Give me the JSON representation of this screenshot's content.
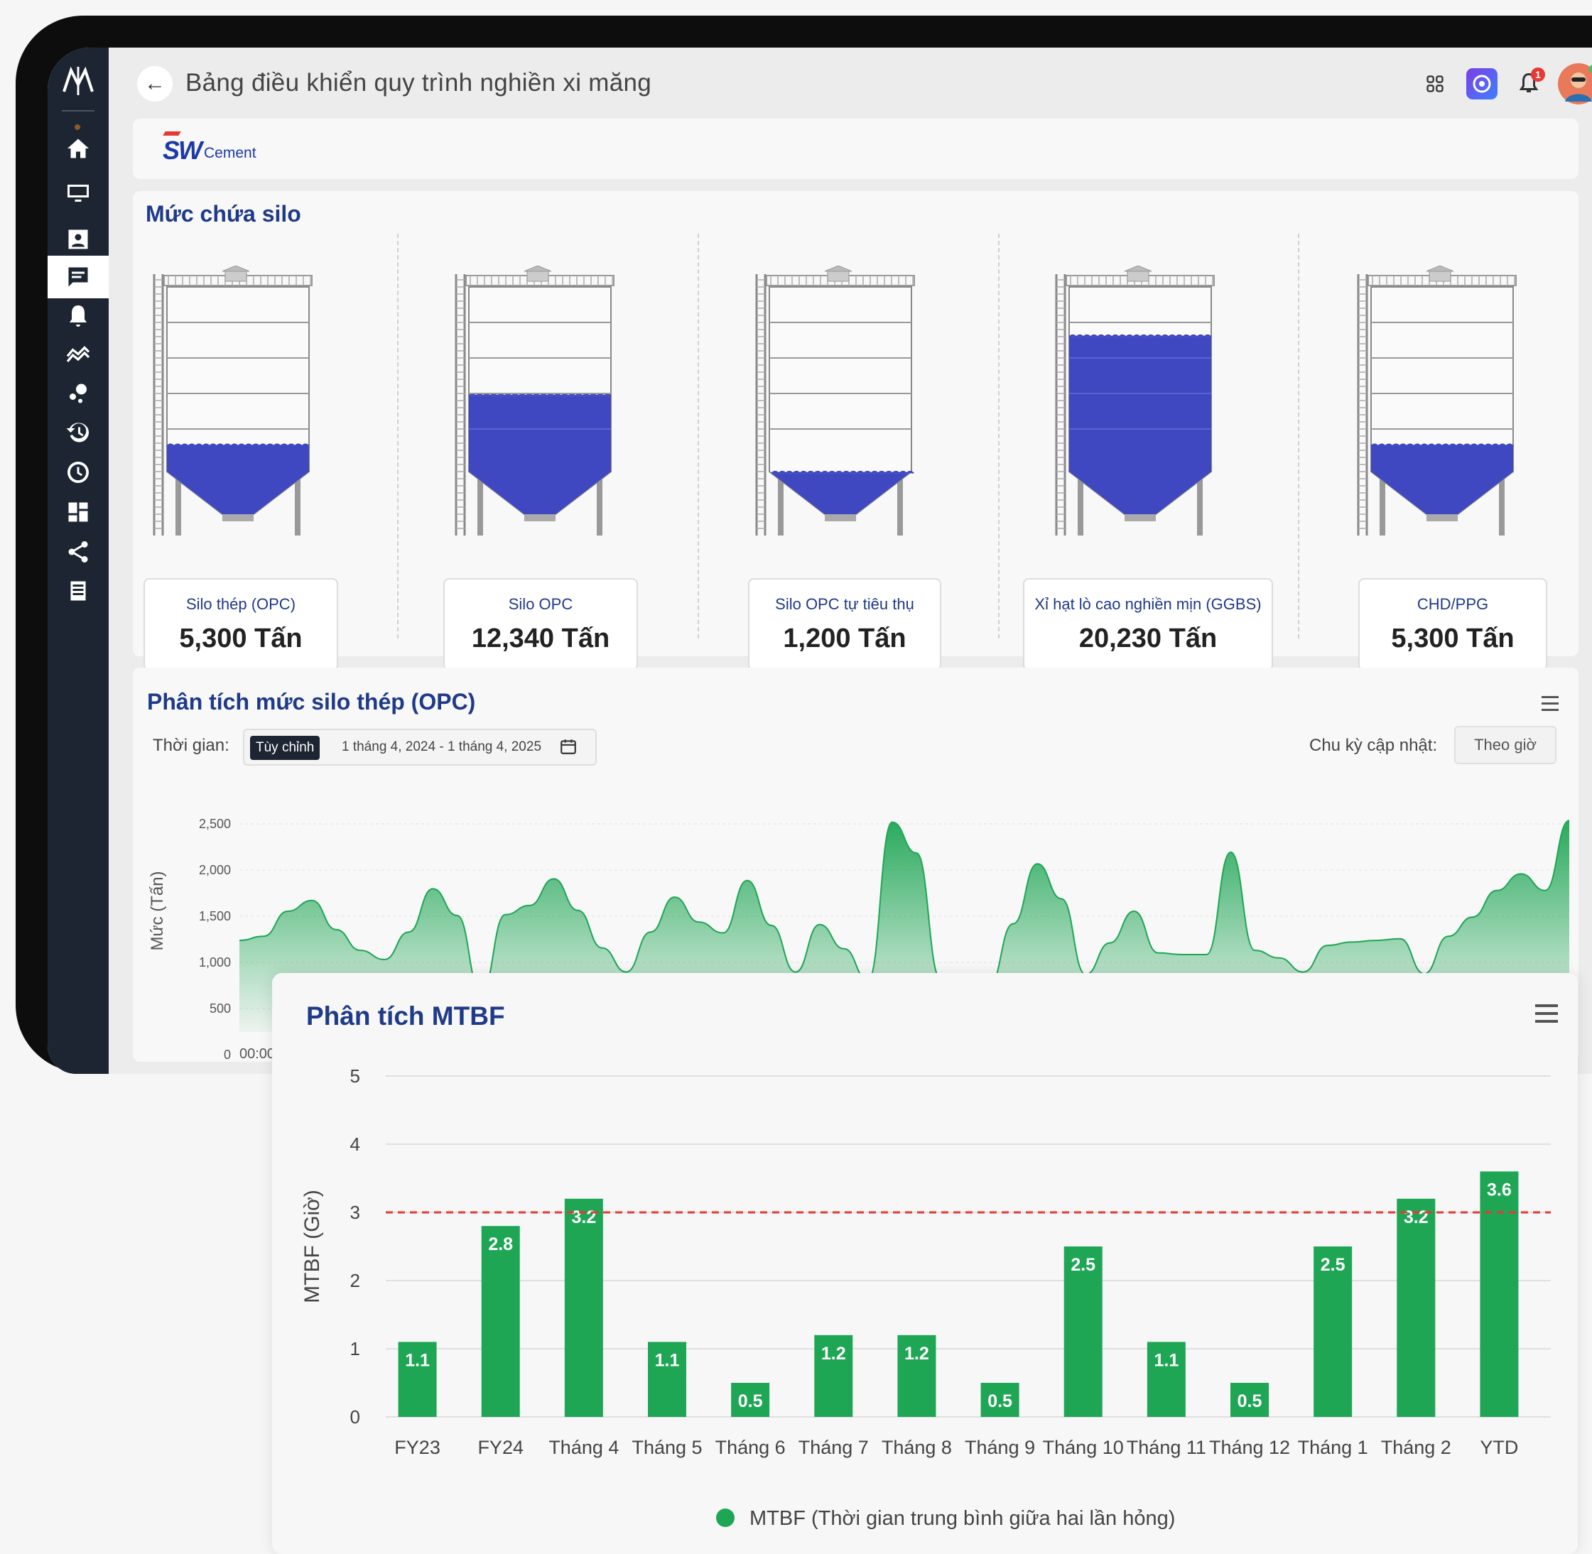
{
  "header": {
    "title": "Bảng điều khiển quy trình nghiền xi măng",
    "back_icon": "←",
    "notification_badge": "1"
  },
  "brand": {
    "sw": "SW",
    "cement": "Cement"
  },
  "silo_section": {
    "title": "Mức chứa silo",
    "fill_color": "#3f48c0",
    "silos": [
      {
        "name": "Silo thép (OPC)",
        "value": "5,300 Tấn",
        "fill_level": 0.3
      },
      {
        "name": "Silo OPC",
        "value": "12,340 Tấn",
        "fill_level": 0.52
      },
      {
        "name": "Silo OPC tự tiêu thụ",
        "value": "1,200 Tấn",
        "fill_level": 0.18
      },
      {
        "name": "Xỉ hạt lò cao nghiền mịn (GGBS)",
        "value": "20,230 Tấn",
        "fill_level": 0.78
      },
      {
        "name": "CHD/PPG",
        "value": "5,300 Tấn",
        "fill_level": 0.3
      }
    ]
  },
  "level_chart": {
    "title": "Phân tích mức silo thép (OPC)",
    "time_label": "Thời gian:",
    "custom_chip": "Tùy chỉnh",
    "date_range": "1 tháng 4, 2024 - 1 tháng 4, 2025",
    "cycle_label": "Chu kỳ cập nhật:",
    "cycle_value": "Theo giờ",
    "ylabel": "Mức (Tấn)",
    "y_ticks": [
      "0",
      "500",
      "1,000",
      "1,500",
      "2,000",
      "2,500"
    ],
    "x_first_tick": "00:00",
    "color": "#1fa655"
  },
  "chart_data": [
    {
      "type": "area",
      "title": "Phân tích mức silo thép (OPC)",
      "ylabel": "Mức (Tấn)",
      "ylim": [
        0,
        2500
      ],
      "x": [
        "00:00"
      ],
      "series": [
        {
          "values": [
            1100,
            1150,
            1450,
            1580,
            1230,
            980,
            870,
            1200,
            1720,
            1400,
            470,
            1410,
            1520,
            1840,
            1460,
            1010,
            720,
            1200,
            1620,
            1320,
            1190,
            1820,
            1280,
            720,
            1290,
            1000,
            620,
            2520,
            2150,
            640,
            420,
            550,
            1300,
            2020,
            1600,
            690,
            1070,
            1450,
            950,
            930,
            930,
            2160,
            980,
            890,
            720,
            1040,
            1080,
            1100,
            1120,
            700,
            1150,
            1380,
            1700,
            1900,
            1700,
            2540
          ]
        }
      ]
    },
    {
      "type": "bar",
      "title": "Phân tích MTBF",
      "ylabel": "MTBF (Giờ)",
      "ylim": [
        0,
        5
      ],
      "y_ticks": [
        0,
        1,
        2,
        3,
        4,
        5
      ],
      "target_line": 3,
      "categories": [
        "FY23",
        "FY24",
        "Tháng 4",
        "Tháng 5",
        "Tháng 6",
        "Tháng 7",
        "Tháng 8",
        "Tháng 9",
        "Tháng 10",
        "Tháng 11",
        "Tháng 12",
        "Tháng 1",
        "Tháng 2",
        "YTD"
      ],
      "series": [
        {
          "name": "MTBF (Thời gian trung bình giữa hai lần hỏng)",
          "values": [
            1.1,
            2.8,
            3.2,
            1.1,
            0.5,
            1.2,
            1.2,
            0.5,
            2.5,
            1.1,
            0.5,
            2.5,
            3.2,
            3.6
          ],
          "color": "#1fa655"
        }
      ],
      "legend_position": "bottom"
    }
  ],
  "mtbf": {
    "title": "Phân tích MTBF",
    "ylabel": "MTBF (Giờ)",
    "legend": "MTBF (Thời gian trung bình giữa hai lần hỏng)",
    "bar_color": "#1fa655",
    "target_color": "#e53935"
  }
}
